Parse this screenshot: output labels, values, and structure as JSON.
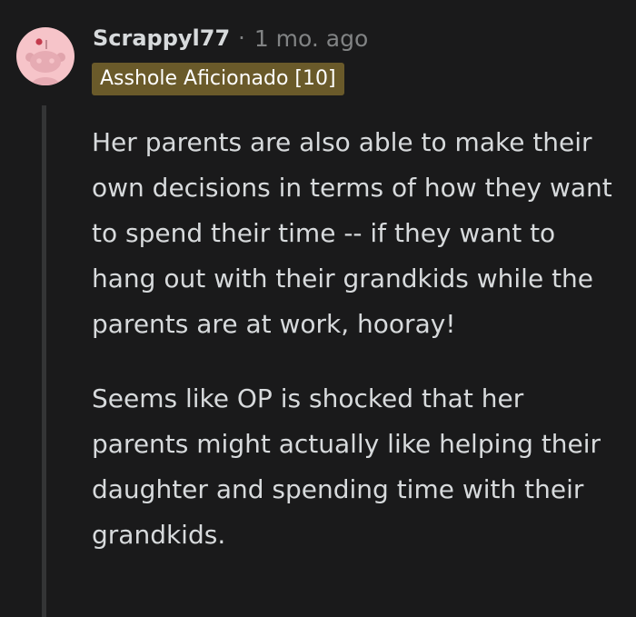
{
  "comment": {
    "author": "Scrappyl77",
    "separator": "·",
    "timestamp": "1 mo. ago",
    "flair": "Asshole Aficionado [10]",
    "avatar_icon": "reddit-snoo-icon",
    "paragraphs": [
      "Her parents are also able to make their own decisions in terms of how they want to spend their time -- if they want to hang out with their grandkids while the parents are at work, hooray!",
      "Seems like OP is shocked that her parents might actually like helping their daughter and spending time with their grandkids."
    ]
  },
  "colors": {
    "background": "#1a1a1b",
    "text": "#d7dadc",
    "muted": "#818384",
    "flair_background": "#6a5a2a",
    "avatar_background": "#f6c4c9",
    "thread_line": "#343536"
  }
}
